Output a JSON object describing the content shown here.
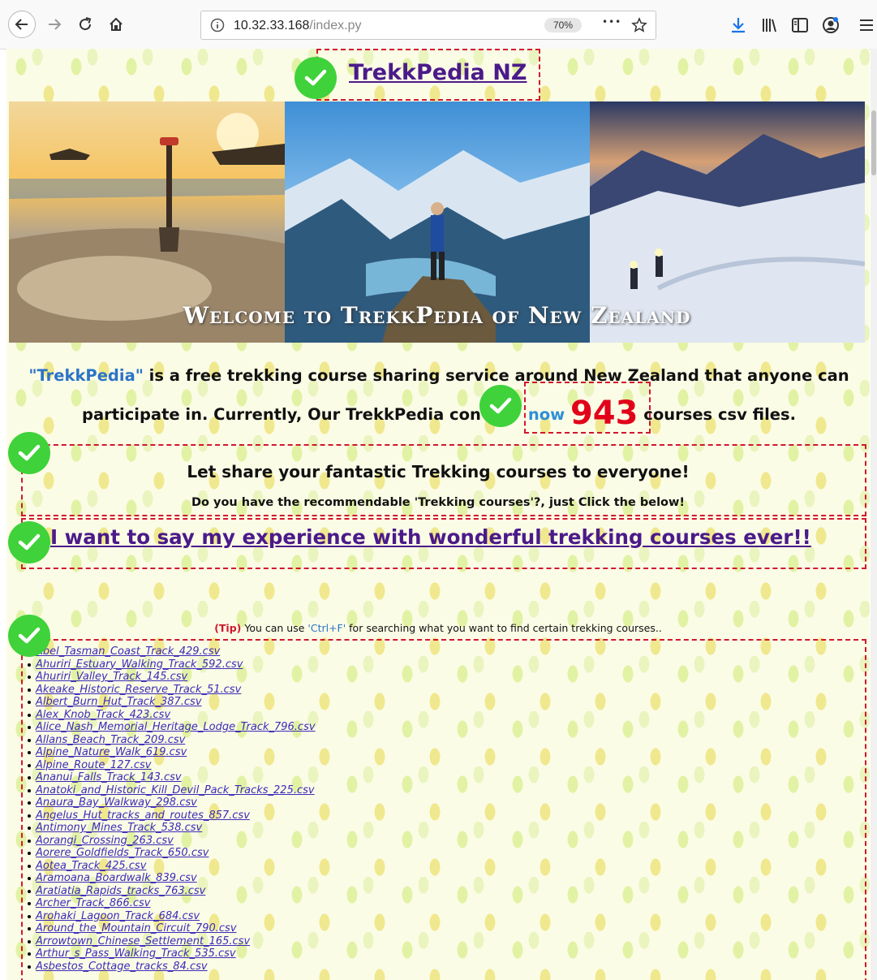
{
  "browser": {
    "url_host": "10.32.33.168",
    "url_path": "/index.py",
    "zoom": "70%",
    "overflow_menu": "•••"
  },
  "site": {
    "title": "TrekkPedia NZ",
    "banner_caption": "Welcome to TrekkPedia of New Zealand"
  },
  "intro": {
    "brand": "\"TrekkPedia\"",
    "line1_rest": " is a free trekking course sharing service around New Zealand that anyone can",
    "line2": "participate in. Currently, Our TrekkPedia con",
    "now_word": "now",
    "count": "943",
    "suffix": "courses csv files."
  },
  "share": {
    "heading": "Let share your fantastic Trekking courses to everyone!",
    "subheading": "Do you have the recommendable 'Trekking courses'?, just Click the below!",
    "link": "I want to say my experience with wonderful trekking courses ever!!"
  },
  "tip": {
    "label": "(Tip)",
    "before": " You can use ",
    "shortcut": "'Ctrl+F'",
    "after": " for searching what you want to find certain trekking courses.."
  },
  "courses": [
    "Abel_Tasman_Coast_Track_429.csv",
    "Ahuriri_Estuary_Walking_Track_592.csv",
    "Ahuriri_Valley_Track_145.csv",
    "Akeake_Historic_Reserve_Track_51.csv",
    "Albert_Burn_Hut_Track_387.csv",
    "Alex_Knob_Track_423.csv",
    "Alice_Nash_Memorial_Heritage_Lodge_Track_796.csv",
    "Allans_Beach_Track_209.csv",
    "Alpine_Nature_Walk_619.csv",
    "Alpine_Route_127.csv",
    "Ananui_Falls_Track_143.csv",
    "Anatoki_and_Historic_Kill_Devil_Pack_Tracks_225.csv",
    "Anaura_Bay_Walkway_298.csv",
    "Angelus_Hut_tracks_and_routes_857.csv",
    "Antimony_Mines_Track_538.csv",
    "Aorangi_Crossing_263.csv",
    "Aorere_Goldfields_Track_650.csv",
    "Aotea_Track_425.csv",
    "Aramoana_Boardwalk_839.csv",
    "Aratiatia_Rapids_tracks_763.csv",
    "Archer_Track_866.csv",
    "Arohaki_Lagoon_Track_684.csv",
    "Around_the_Mountain_Circuit_790.csv",
    "Arrowtown_Chinese_Settlement_165.csv",
    "Arthur_s_Pass_Walking_Track_535.csv",
    "Asbestos_Cottage_tracks_84.csv"
  ]
}
